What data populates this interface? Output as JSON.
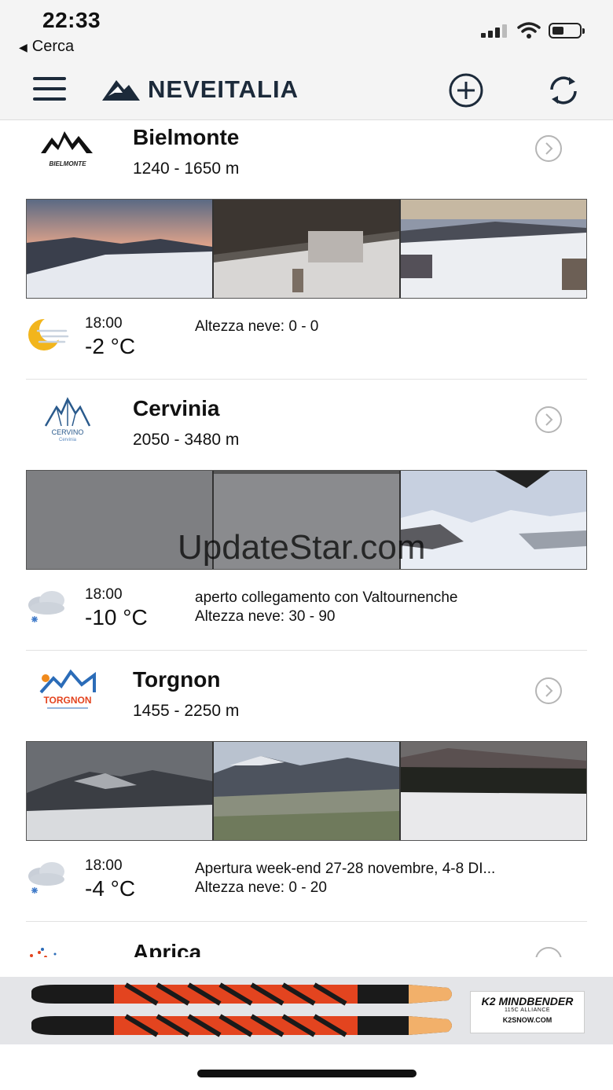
{
  "status_bar": {
    "time": "22:33",
    "back_label": "Cerca"
  },
  "header": {
    "app_name": "NEVEITALIA",
    "menu_icon": "hamburger-menu-icon",
    "add_icon": "plus-circle-icon",
    "refresh_icon": "refresh-icon"
  },
  "resorts": [
    {
      "name": "Bielmonte",
      "altitude": "1240 - 1650 m",
      "logo_text": "BIELMONTE",
      "time": "18:00",
      "temperature": "-2 °C",
      "info_line_1": "Altezza neve: 0 - 0",
      "info_line_2": "",
      "weather_icon": "moon-haze-icon"
    },
    {
      "name": "Cervinia",
      "altitude": "2050 - 3480 m",
      "logo_text": "CERVINO",
      "logo_subtext": "Cervinia",
      "time": "18:00",
      "temperature": "-10 °C",
      "info_line_1": "aperto collegamento con Valtournenche",
      "info_line_2": "Altezza neve: 30 - 90",
      "weather_icon": "snow-cloud-icon"
    },
    {
      "name": "Torgnon",
      "altitude": "1455 - 2250 m",
      "logo_text": "TORGNON",
      "time": "18:00",
      "temperature": "-4 °C",
      "info_line_1": "Apertura week-end 27-28 novembre, 4-8 DI...",
      "info_line_2": "Altezza neve: 0 - 20",
      "weather_icon": "snow-cloud-icon"
    },
    {
      "name": "Aprica"
    }
  ],
  "ad": {
    "brand": "K2 MINDBENDER",
    "product": "115C ALLIANCE",
    "site": "K2SNOW.COM"
  },
  "watermark": "UpdateStar.com",
  "colors": {
    "navy": "#1c2a3a",
    "chevron": "#b5b5b5",
    "sun": "#f2b51c",
    "ski_orange": "#e3441f"
  }
}
